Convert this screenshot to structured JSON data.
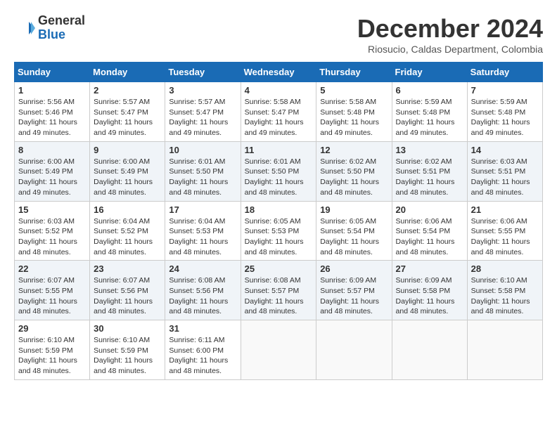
{
  "header": {
    "logo_general": "General",
    "logo_blue": "Blue",
    "month_title": "December 2024",
    "location": "Riosucio, Caldas Department, Colombia"
  },
  "calendar": {
    "days_of_week": [
      "Sunday",
      "Monday",
      "Tuesday",
      "Wednesday",
      "Thursday",
      "Friday",
      "Saturday"
    ],
    "weeks": [
      [
        {
          "day": 1,
          "sunrise": "5:56 AM",
          "sunset": "5:46 PM",
          "daylight": "11 hours and 49 minutes."
        },
        {
          "day": 2,
          "sunrise": "5:57 AM",
          "sunset": "5:47 PM",
          "daylight": "11 hours and 49 minutes."
        },
        {
          "day": 3,
          "sunrise": "5:57 AM",
          "sunset": "5:47 PM",
          "daylight": "11 hours and 49 minutes."
        },
        {
          "day": 4,
          "sunrise": "5:58 AM",
          "sunset": "5:47 PM",
          "daylight": "11 hours and 49 minutes."
        },
        {
          "day": 5,
          "sunrise": "5:58 AM",
          "sunset": "5:48 PM",
          "daylight": "11 hours and 49 minutes."
        },
        {
          "day": 6,
          "sunrise": "5:59 AM",
          "sunset": "5:48 PM",
          "daylight": "11 hours and 49 minutes."
        },
        {
          "day": 7,
          "sunrise": "5:59 AM",
          "sunset": "5:48 PM",
          "daylight": "11 hours and 49 minutes."
        }
      ],
      [
        {
          "day": 8,
          "sunrise": "6:00 AM",
          "sunset": "5:49 PM",
          "daylight": "11 hours and 49 minutes."
        },
        {
          "day": 9,
          "sunrise": "6:00 AM",
          "sunset": "5:49 PM",
          "daylight": "11 hours and 48 minutes."
        },
        {
          "day": 10,
          "sunrise": "6:01 AM",
          "sunset": "5:50 PM",
          "daylight": "11 hours and 48 minutes."
        },
        {
          "day": 11,
          "sunrise": "6:01 AM",
          "sunset": "5:50 PM",
          "daylight": "11 hours and 48 minutes."
        },
        {
          "day": 12,
          "sunrise": "6:02 AM",
          "sunset": "5:50 PM",
          "daylight": "11 hours and 48 minutes."
        },
        {
          "day": 13,
          "sunrise": "6:02 AM",
          "sunset": "5:51 PM",
          "daylight": "11 hours and 48 minutes."
        },
        {
          "day": 14,
          "sunrise": "6:03 AM",
          "sunset": "5:51 PM",
          "daylight": "11 hours and 48 minutes."
        }
      ],
      [
        {
          "day": 15,
          "sunrise": "6:03 AM",
          "sunset": "5:52 PM",
          "daylight": "11 hours and 48 minutes."
        },
        {
          "day": 16,
          "sunrise": "6:04 AM",
          "sunset": "5:52 PM",
          "daylight": "11 hours and 48 minutes."
        },
        {
          "day": 17,
          "sunrise": "6:04 AM",
          "sunset": "5:53 PM",
          "daylight": "11 hours and 48 minutes."
        },
        {
          "day": 18,
          "sunrise": "6:05 AM",
          "sunset": "5:53 PM",
          "daylight": "11 hours and 48 minutes."
        },
        {
          "day": 19,
          "sunrise": "6:05 AM",
          "sunset": "5:54 PM",
          "daylight": "11 hours and 48 minutes."
        },
        {
          "day": 20,
          "sunrise": "6:06 AM",
          "sunset": "5:54 PM",
          "daylight": "11 hours and 48 minutes."
        },
        {
          "day": 21,
          "sunrise": "6:06 AM",
          "sunset": "5:55 PM",
          "daylight": "11 hours and 48 minutes."
        }
      ],
      [
        {
          "day": 22,
          "sunrise": "6:07 AM",
          "sunset": "5:55 PM",
          "daylight": "11 hours and 48 minutes."
        },
        {
          "day": 23,
          "sunrise": "6:07 AM",
          "sunset": "5:56 PM",
          "daylight": "11 hours and 48 minutes."
        },
        {
          "day": 24,
          "sunrise": "6:08 AM",
          "sunset": "5:56 PM",
          "daylight": "11 hours and 48 minutes."
        },
        {
          "day": 25,
          "sunrise": "6:08 AM",
          "sunset": "5:57 PM",
          "daylight": "11 hours and 48 minutes."
        },
        {
          "day": 26,
          "sunrise": "6:09 AM",
          "sunset": "5:57 PM",
          "daylight": "11 hours and 48 minutes."
        },
        {
          "day": 27,
          "sunrise": "6:09 AM",
          "sunset": "5:58 PM",
          "daylight": "11 hours and 48 minutes."
        },
        {
          "day": 28,
          "sunrise": "6:10 AM",
          "sunset": "5:58 PM",
          "daylight": "11 hours and 48 minutes."
        }
      ],
      [
        {
          "day": 29,
          "sunrise": "6:10 AM",
          "sunset": "5:59 PM",
          "daylight": "11 hours and 48 minutes."
        },
        {
          "day": 30,
          "sunrise": "6:10 AM",
          "sunset": "5:59 PM",
          "daylight": "11 hours and 48 minutes."
        },
        {
          "day": 31,
          "sunrise": "6:11 AM",
          "sunset": "6:00 PM",
          "daylight": "11 hours and 48 minutes."
        },
        null,
        null,
        null,
        null
      ]
    ]
  }
}
